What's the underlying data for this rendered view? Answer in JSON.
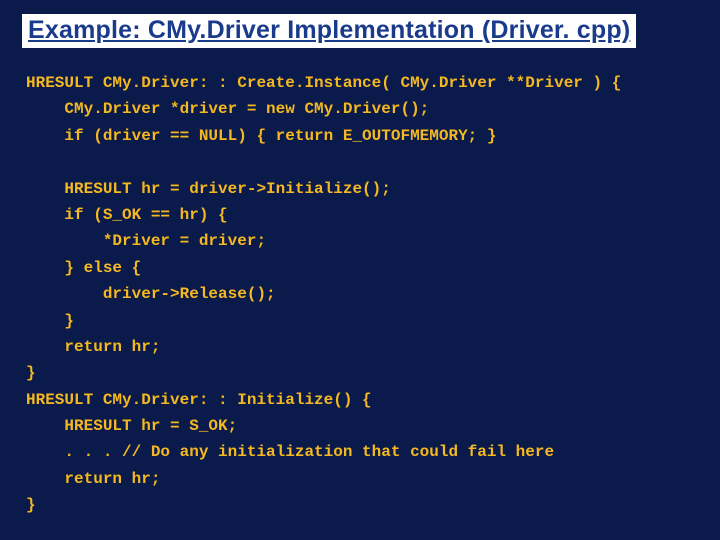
{
  "title": "Example: CMy.Driver Implementation  (Driver. cpp)",
  "code_lines": [
    "HRESULT CMy.Driver: : Create.Instance( CMy.Driver **Driver ) {",
    "    CMy.Driver *driver = new CMy.Driver();",
    "    if (driver == NULL) { return E_OUTOFMEMORY; }",
    "",
    "    HRESULT hr = driver->Initialize();",
    "    if (S_OK == hr) {",
    "        *Driver = driver;",
    "    } else {",
    "        driver->Release();",
    "    }",
    "    return hr;",
    "}",
    "HRESULT CMy.Driver: : Initialize() {",
    "    HRESULT hr = S_OK;",
    "    . . . // Do any initialization that could fail here",
    "    return hr;",
    "}"
  ]
}
